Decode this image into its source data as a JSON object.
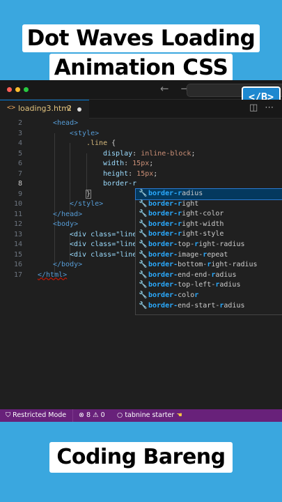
{
  "title": {
    "line1": "Dot Waves Loading",
    "line2": "Animation CSS"
  },
  "window": {
    "traffic_lights": [
      "#ff5f57",
      "#febc2e",
      "#28c840"
    ],
    "nav_arrows": "← →",
    "logo_text": "</B>"
  },
  "tab": {
    "icon": "<>",
    "filename": "loading3.html",
    "problem_count": "2",
    "dirty_indicator": "●",
    "tools": [
      "split-editor-icon",
      "more-actions-icon"
    ]
  },
  "editor": {
    "line_numbers": [
      "2",
      "3",
      "4",
      "5",
      "6",
      "7",
      "8",
      "9",
      "10",
      "11",
      "12",
      "13",
      "14",
      "15",
      "16",
      "17"
    ],
    "current_line": "8",
    "code": {
      "l2": "<head>",
      "l3": "<style>",
      "l4_sel": ".line",
      "l4_brace": " {",
      "l5_prop": "display",
      "l5_val": "inline-block",
      "l6_prop": "width",
      "l6_val": "15px",
      "l7_prop": "height",
      "l7_val": "15px",
      "l8_prop": "border-r",
      "l9": "}",
      "l10": "</style>",
      "l11": "</head>",
      "l12": "<body>",
      "l13": "<div class=\"line",
      "l14": "<div class=\"line",
      "l15": "<div class=\"line",
      "l16": "</body>",
      "l17": "</html>"
    }
  },
  "suggestions": {
    "matched_prefix": "border-r",
    "items": [
      {
        "pre": "border-r",
        "rest": "adius",
        "selected": true
      },
      {
        "pre": "border-r",
        "rest": "ight",
        "selected": false
      },
      {
        "pre": "border-r",
        "rest": "ight-color",
        "selected": false
      },
      {
        "pre": "border-r",
        "rest": "ight-width",
        "selected": false
      },
      {
        "pre": "border-r",
        "rest": "ight-style",
        "selected": false
      },
      {
        "pre": "border-",
        "mid": "top-",
        "m2": "r",
        "rest": "ight-radius",
        "selected": false
      },
      {
        "pre": "border-",
        "mid": "image-",
        "m2": "r",
        "rest": "epeat",
        "selected": false
      },
      {
        "pre": "border-",
        "mid": "bottom-",
        "m2": "r",
        "rest": "ight-radius",
        "selected": false
      },
      {
        "pre": "border-",
        "mid": "end-end-",
        "m2": "r",
        "rest": "adius",
        "selected": false
      },
      {
        "pre": "border-",
        "mid": "top-left-",
        "m2": "r",
        "rest": "adius",
        "selected": false
      },
      {
        "pre": "border-",
        "mid": "colo",
        "m2": "r",
        "rest": "",
        "selected": false
      },
      {
        "pre": "border-",
        "mid": "end-start-",
        "m2": "r",
        "rest": "adius",
        "selected": false
      }
    ]
  },
  "statusbar": {
    "restricted": "Restricted Mode",
    "errors": "8",
    "warnings": "0",
    "tabnine": "tabnine starter",
    "color": "#68217a"
  },
  "footer": {
    "brand": "Coding Bareng"
  }
}
